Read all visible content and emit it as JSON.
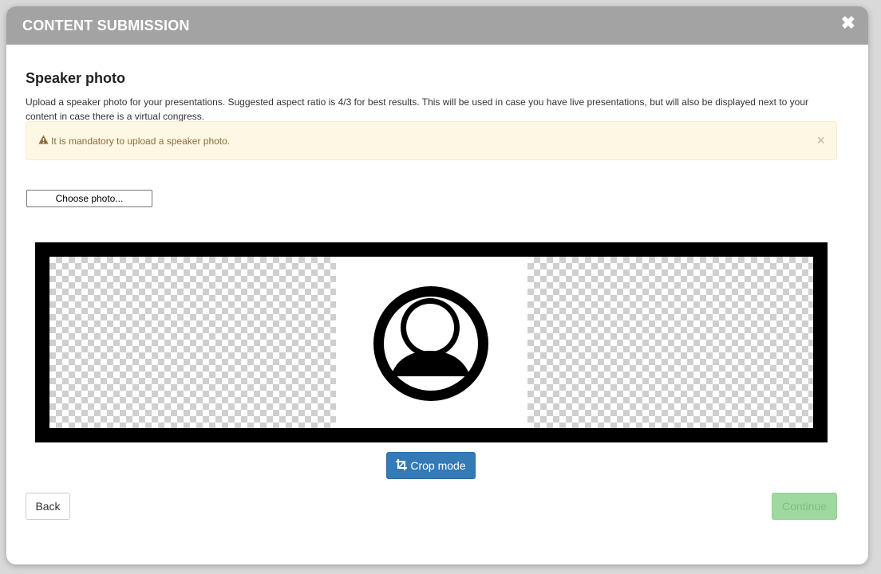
{
  "modal": {
    "title": "CONTENT SUBMISSION",
    "close_icon": "close-icon"
  },
  "section": {
    "title": "Speaker photo",
    "description": "Upload a speaker photo for your presentations. Suggested aspect ratio is 4/3 for best results. This will be used in case you have live presentations, but will also be displayed next to your content in case there is a virtual congress."
  },
  "alert": {
    "icon": "warning-icon",
    "text": "It is mandatory to upload a speaker photo.",
    "close_icon": "close-icon"
  },
  "upload": {
    "button_label": "Choose photo..."
  },
  "preview": {
    "placeholder_icon": "user-avatar-icon"
  },
  "crop": {
    "icon": "crop-icon",
    "label": "Crop mode"
  },
  "footer": {
    "back_label": "Back",
    "continue_label": "Continue"
  },
  "colors": {
    "header_bg": "#a3a3a3",
    "alert_bg": "#fcf8e3",
    "alert_text": "#8a6d3b",
    "primary": "#337ab7",
    "success_disabled": "#9fd99f"
  }
}
